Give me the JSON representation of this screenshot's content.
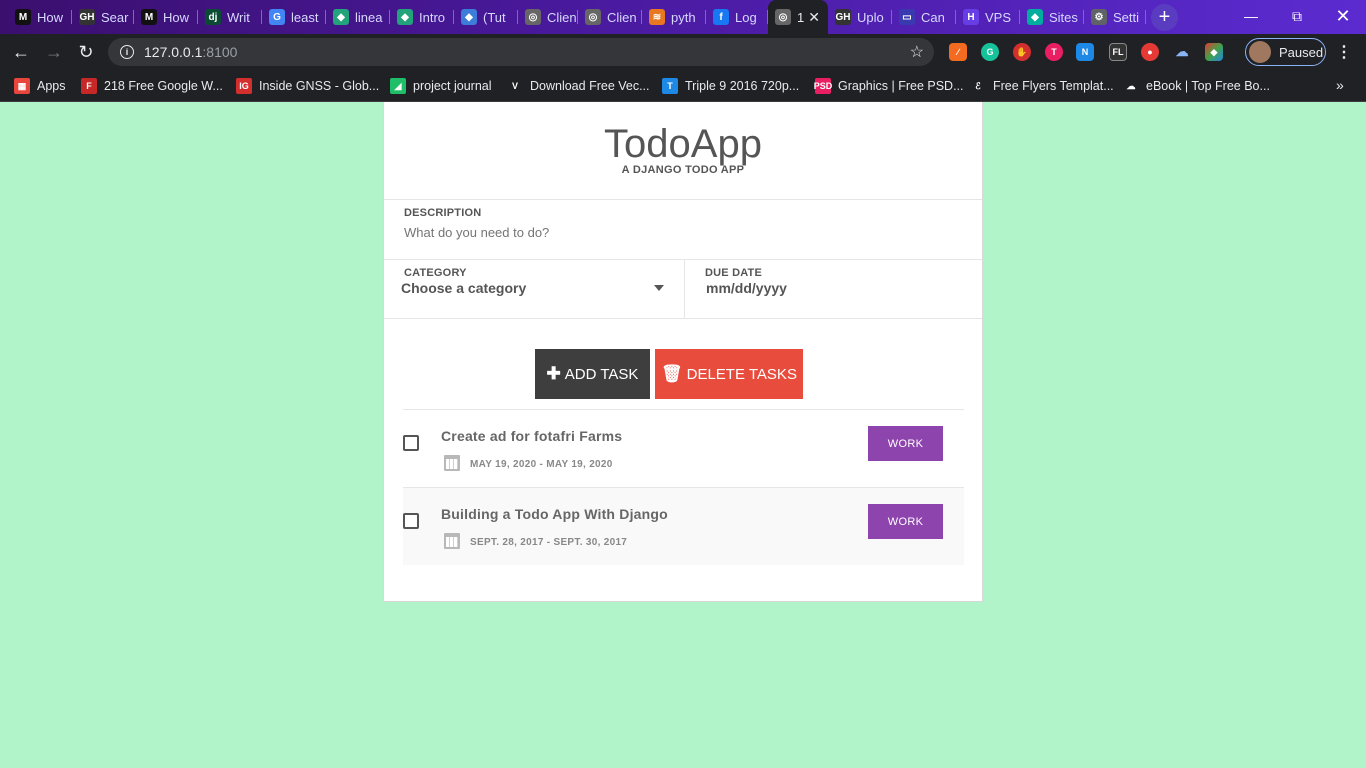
{
  "browser": {
    "tabs": [
      {
        "label": "How",
        "icon": "M",
        "color": "#111"
      },
      {
        "label": "Sear",
        "icon": "GH",
        "color": "#333"
      },
      {
        "label": "How",
        "icon": "M",
        "color": "#111"
      },
      {
        "label": "Writ",
        "icon": "dj",
        "color": "#0c4b33"
      },
      {
        "label": "least",
        "icon": "G",
        "color": "#4285f4"
      },
      {
        "label": "linea",
        "icon": "◆",
        "color": "#23a37b"
      },
      {
        "label": "Intro",
        "icon": "◆",
        "color": "#23a37b"
      },
      {
        "label": "(Tut",
        "icon": "◆",
        "color": "#3b7dd8"
      },
      {
        "label": "Clien",
        "icon": "◎",
        "color": "#666"
      },
      {
        "label": "Clien",
        "icon": "◎",
        "color": "#666"
      },
      {
        "label": "pyth",
        "icon": "≋",
        "color": "#e87722"
      },
      {
        "label": "Log",
        "icon": "f",
        "color": "#1877f2"
      },
      {
        "label": "1",
        "icon": "◎",
        "color": "#666",
        "active": true
      },
      {
        "label": "Uplo",
        "icon": "GH",
        "color": "#333"
      },
      {
        "label": "Can",
        "icon": "▭",
        "color": "#3a3ab0"
      },
      {
        "label": "VPS",
        "icon": "H",
        "color": "#673de6"
      },
      {
        "label": "Sites",
        "icon": "◆",
        "color": "#00ad9f"
      },
      {
        "label": "Setti",
        "icon": "⚙",
        "color": "#5f6368"
      }
    ],
    "url_host": "127.0.0.1",
    "url_port": ":8100",
    "profile_label": "Paused",
    "bookmarks": [
      {
        "label": "Apps",
        "icon": "▦",
        "color": "#e8453c"
      },
      {
        "label": "218 Free Google W...",
        "icon": "F",
        "color": "#c62828"
      },
      {
        "label": "Inside GNSS - Glob...",
        "icon": "IG",
        "color": "#d32f2f"
      },
      {
        "label": "project journal",
        "icon": "◢",
        "color": "#1fbf6a"
      },
      {
        "label": "Download Free Vec...",
        "icon": "V",
        "color": "#202124"
      },
      {
        "label": "Triple 9 2016 720p...",
        "icon": "T",
        "color": "#1e88e5"
      },
      {
        "label": "Graphics | Free PSD...",
        "icon": "PSD",
        "color": "#e91e63"
      },
      {
        "label": "Free Flyers Templat...",
        "icon": "ℰ",
        "color": "#202124"
      },
      {
        "label": "eBook | Top Free Bo...",
        "icon": "☁",
        "color": "#202124"
      }
    ]
  },
  "app": {
    "title": "TodoApp",
    "subtitle": "A DJANGO TODO APP",
    "description_label": "DESCRIPTION",
    "description_placeholder": "What do you need to do?",
    "category_label": "CATEGORY",
    "category_value": "Choose a category",
    "due_date_label": "DUE DATE",
    "due_date_placeholder": "mm/dd/yyyy",
    "add_button": "ADD TASK",
    "delete_button": "DELETE TASKS",
    "tasks": [
      {
        "title": "Create ad for fotafri Farms",
        "dates": "MAY 19, 2020 - MAY 19, 2020",
        "category": "WORK"
      },
      {
        "title": "Building a Todo App With Django",
        "dates": "SEPT. 28, 2017 - SEPT. 30, 2017",
        "category": "WORK"
      }
    ],
    "colors": {
      "background": "#b1f4c9",
      "add_button": "#3e3e3e",
      "delete_button": "#e84c3d",
      "badge": "#8e44ad"
    }
  }
}
